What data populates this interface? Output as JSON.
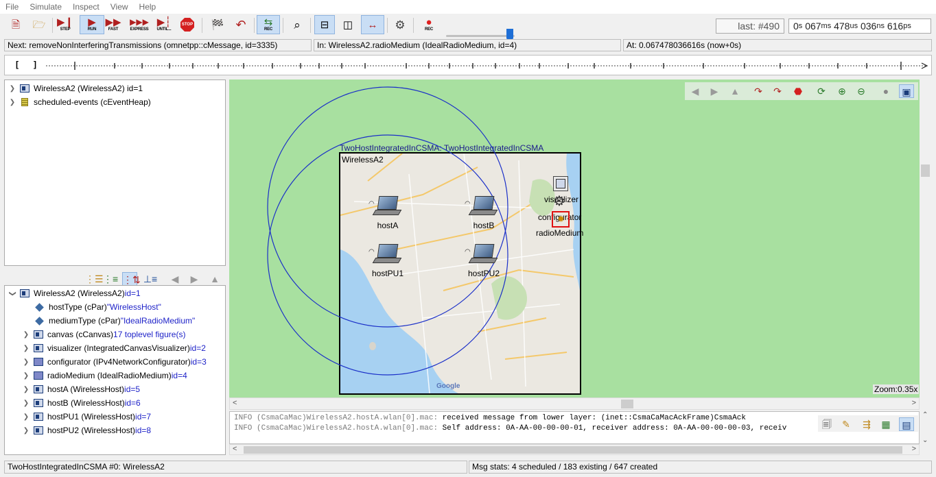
{
  "menu": [
    "File",
    "Simulate",
    "Inspect",
    "View",
    "Help"
  ],
  "toolbar": {
    "step": "STEP",
    "run": "RUN",
    "fast": "FAST",
    "express": "EXPRESS",
    "until": "UNTIL...",
    "stop": "STOP",
    "rec": "REC",
    "event_label": "last: #490",
    "simtime": {
      "s": "0",
      "ms": "067",
      "us": "478",
      "ns": "036",
      "ps": "616",
      "u_s": "s",
      "u_ms": "ms",
      "u_us": "us",
      "u_ns": "ns",
      "u_ps": "ps"
    }
  },
  "status": {
    "next": "Next: removeNonInterferingTransmissions (omnetpp::cMessage, id=3335)",
    "in": "In: WirelessA2.radioMedium (IdealRadioMedium, id=4)",
    "at": "At: 0.067478036616s (now+0s)"
  },
  "timeline": {
    "left_bracket": "[",
    "right_bracket": "]"
  },
  "object_tree": [
    {
      "label": "WirelessA2 (WirelessA2) id=1",
      "icon": "module-icon"
    },
    {
      "label": "scheduled-events (cEventHeap)",
      "icon": "event-heap-icon"
    }
  ],
  "inspector": {
    "root": {
      "label": "WirelessA2 (WirelessA2) ",
      "id": "id=1"
    },
    "items": [
      {
        "name": "hostType (cPar) ",
        "value": "\"WirelessHost\"",
        "icon": "par",
        "expand": false
      },
      {
        "name": "mediumType (cPar) ",
        "value": "\"IdealRadioMedium\"",
        "icon": "par",
        "expand": false
      },
      {
        "name": "canvas (cCanvas) ",
        "value": "17 toplevel figure(s)",
        "icon": "module",
        "expand": true
      },
      {
        "name": "visualizer (IntegratedCanvasVisualizer) ",
        "value": "id=2",
        "icon": "module",
        "expand": true
      },
      {
        "name": "configurator (IPv4NetworkConfigurator) ",
        "value": "id=3",
        "icon": "simple",
        "expand": true
      },
      {
        "name": "radioMedium (IdealRadioMedium) ",
        "value": "id=4",
        "icon": "simple",
        "expand": true
      },
      {
        "name": "hostA (WirelessHost) ",
        "value": "id=5",
        "icon": "module",
        "expand": true
      },
      {
        "name": "hostB (WirelessHost) ",
        "value": "id=6",
        "icon": "module",
        "expand": true
      },
      {
        "name": "hostPU1 (WirelessHost) ",
        "value": "id=7",
        "icon": "module",
        "expand": true
      },
      {
        "name": "hostPU2 (WirelessHost) ",
        "value": "id=8",
        "icon": "module",
        "expand": true
      }
    ]
  },
  "network": {
    "title": "TwoHostIntegratedInCSMA: TwoHostIntegratedInCSMA",
    "box_label": "WirelessA2",
    "hosts": [
      "hostA",
      "hostB",
      "hostPU1",
      "hostPU2"
    ],
    "modules": [
      "visualizer",
      "configurator",
      "radioMedium"
    ],
    "zoom": "Zoom:0.35x",
    "map_credit": "Google"
  },
  "log": [
    {
      "prefix": "INFO (CsmaCaMac)WirelessA2.hostA.wlan[0].mac: ",
      "text": "received message from lower layer: (inet::CsmaCaMacAckFrame)CsmaAck"
    },
    {
      "prefix": "INFO (CsmaCaMac)WirelessA2.hostA.wlan[0].mac: ",
      "text": "Self address: 0A-AA-00-00-00-01, receiver address: 0A-AA-00-00-00-03, receiv"
    }
  ],
  "bottom": {
    "left": "TwoHostIntegratedInCSMA #0: WirelessA2",
    "right": "Msg stats: 4 scheduled / 183 existing / 647 created"
  },
  "colors": {
    "canvas_bg": "#a8e0a0",
    "range_circle": "#1a2fc8",
    "active_button": "#c9def5",
    "link_blue": "#1e22c8"
  }
}
